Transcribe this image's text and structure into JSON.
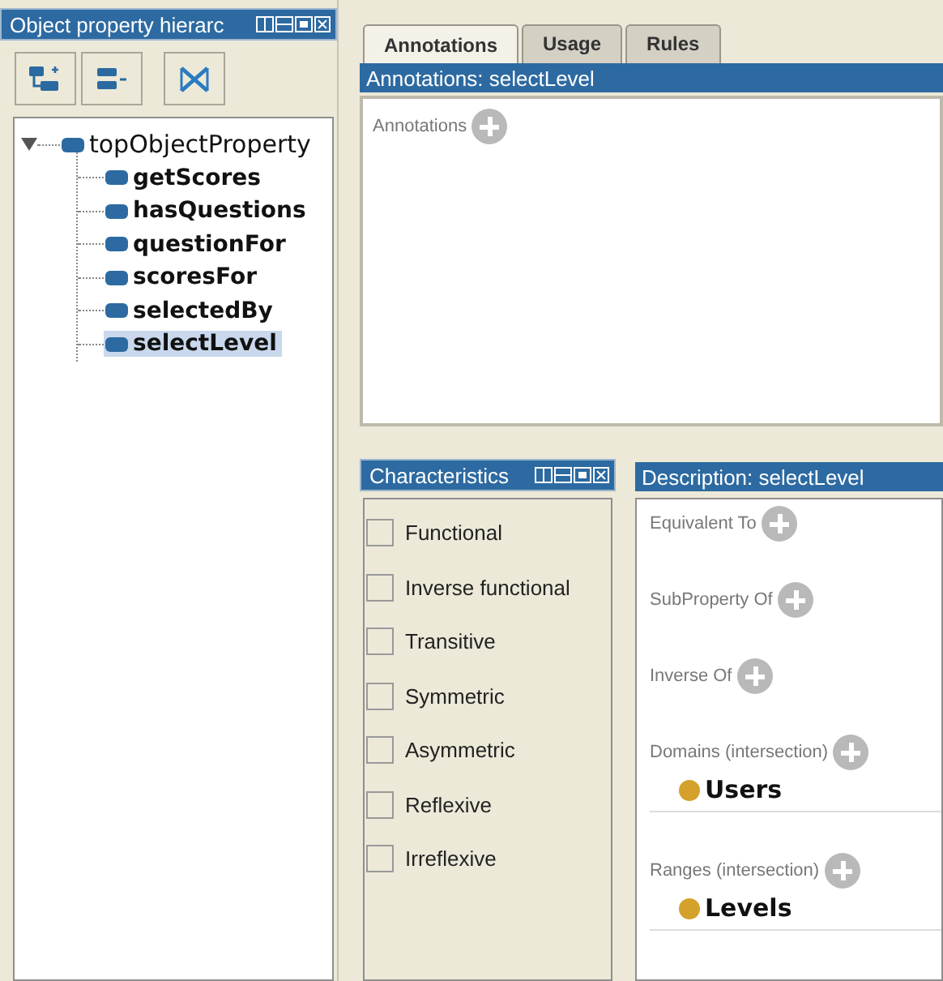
{
  "hierarchy_panel": {
    "title": "Object property hierarc",
    "tree": {
      "label": "topObjectProperty",
      "expanded": true,
      "selected": false,
      "children": [
        {
          "label": "getScores",
          "selected": false
        },
        {
          "label": "hasQuestions",
          "selected": false
        },
        {
          "label": "questionFor",
          "selected": false
        },
        {
          "label": "scoresFor",
          "selected": false
        },
        {
          "label": "selectedBy",
          "selected": false
        },
        {
          "label": "selectLevel",
          "selected": true
        }
      ]
    }
  },
  "tabs": [
    {
      "label": "Annotations",
      "selected": true
    },
    {
      "label": "Usage",
      "selected": false
    },
    {
      "label": "Rules",
      "selected": false
    }
  ],
  "annotations_panel": {
    "title": "Annotations: selectLevel",
    "section_label": "Annotations"
  },
  "characteristics_panel": {
    "title": "Characteristics",
    "items": [
      {
        "label": "Functional",
        "checked": false
      },
      {
        "label": "Inverse functional",
        "checked": false
      },
      {
        "label": "Transitive",
        "checked": false
      },
      {
        "label": "Symmetric",
        "checked": false
      },
      {
        "label": "Asymmetric",
        "checked": false
      },
      {
        "label": "Reflexive",
        "checked": false
      },
      {
        "label": "Irreflexive",
        "checked": false
      }
    ]
  },
  "description_panel": {
    "title": "Description: selectLevel",
    "sections": [
      {
        "label": "Equivalent To"
      },
      {
        "label": "SubProperty Of"
      },
      {
        "label": "Inverse Of"
      },
      {
        "label": "Domains (intersection)",
        "items": [
          {
            "label": "Users",
            "color": "#d4a12a"
          }
        ]
      },
      {
        "label": "Ranges (intersection)",
        "items": [
          {
            "label": "Levels",
            "color": "#d4a12a"
          }
        ]
      }
    ]
  }
}
